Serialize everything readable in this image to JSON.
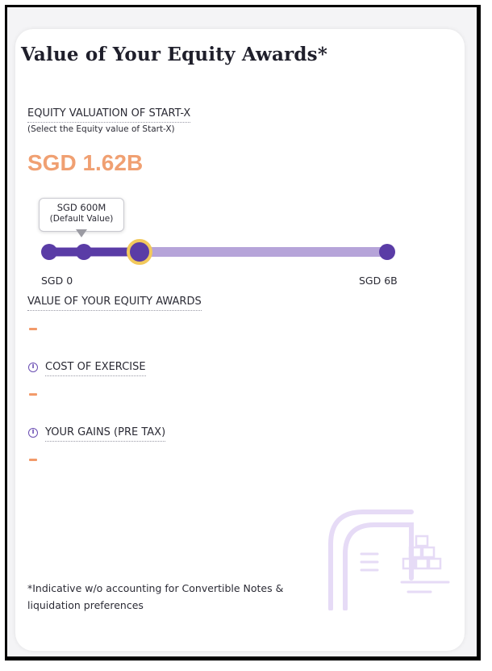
{
  "title": "Value of Your Equity Awards*",
  "valuation": {
    "label": "EQUITY VALUATION OF START-X",
    "sublabel": "(Select the Equity value of Start-X)",
    "current_value": "SGD 1.62B",
    "accent_color": "#f0a072"
  },
  "slider": {
    "min_label": "SGD 0",
    "max_label": "SGD 6B",
    "default_tooltip_line1": "SGD 600M",
    "default_tooltip_line2": "(Default Value)",
    "value_fraction": 0.27,
    "default_fraction": 0.1,
    "track_color": "#b6a4d9",
    "fill_color": "#5a3ca6",
    "thumb_ring_color": "#f2c95c"
  },
  "results": [
    {
      "label": "VALUE OF YOUR EQUITY AWARDS",
      "value": "-",
      "icon": null
    },
    {
      "label": "COST OF EXERCISE",
      "value": "-",
      "icon": "info-icon"
    },
    {
      "label": "YOUR GAINS (PRE TAX)",
      "value": "-",
      "icon": "info-icon"
    }
  ],
  "footnote": "*Indicative w/o accounting for Convertible Notes & liquidation preferences"
}
